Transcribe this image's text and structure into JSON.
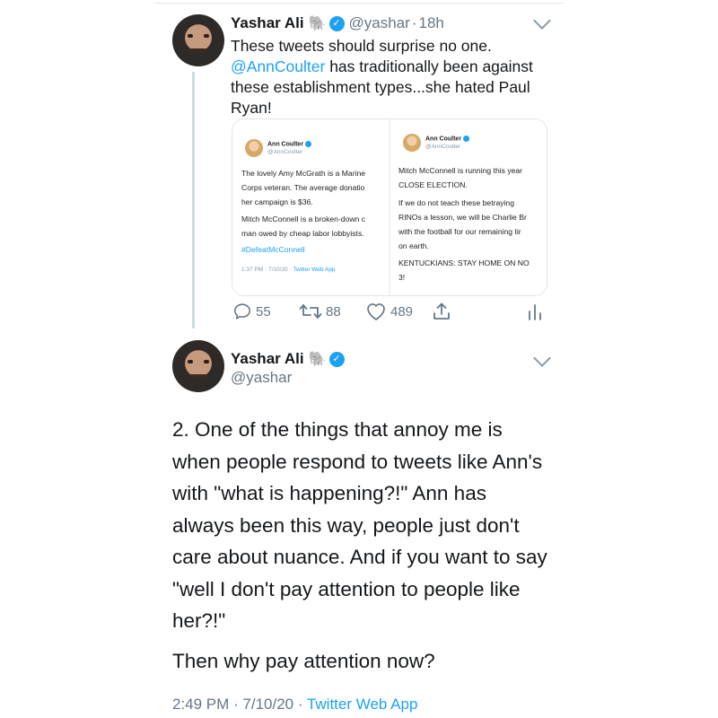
{
  "tweet1": {
    "author_name": "Yashar Ali",
    "handle": "@yashar",
    "separator": "·",
    "time": "18h",
    "text_line1": "These tweets should surprise no one.",
    "mention": "@AnnCoulter",
    "text_after_mention": " has traditionally been against these establishment types...she hated Paul Ryan!",
    "stats": {
      "replies": "55",
      "retweets": "88",
      "likes": "489"
    }
  },
  "embedded": {
    "left": {
      "name": "Ann Coulter",
      "handle": "@AnnCoulter",
      "lines": [
        "The lovely Amy McGrath is a Marine",
        "Corps veteran.  The average donatio",
        "her campaign is $36.",
        "Mitch McConnell is a broken-down c",
        "man owed by cheap labor lobbyists."
      ],
      "hashtag": "#DefeatMcConnell",
      "meta_time": "1:37 PM · 7/10/20 · ",
      "meta_source": "Twitter Web App"
    },
    "right": {
      "name": "Ann Coulter",
      "handle": "@AnnCoulter",
      "lines": [
        "Mitch McConnell is running this year",
        "CLOSE ELECTION.",
        "If we do not teach these betraying",
        "RINOs a lesson, we will be Charlie Br",
        "with the football for our remaining tir",
        "on earth.",
        "KENTUCKIANS: STAY HOME ON NO",
        "3!"
      ]
    }
  },
  "tweet2": {
    "author_name": "Yashar Ali",
    "handle": "@yashar",
    "paragraph1": "2. One of the things that annoy me is when people respond to tweets like Ann's with \"what is happening?!\" Ann has always been this way, people just don't care about nuance. And if you want to say \"well I don't pay attention to people like her?!\"",
    "paragraph2": "Then why pay attention now?",
    "footer_time": "2:49 PM · 7/10/20 · ",
    "footer_source": "Twitter Web App"
  },
  "icons": {
    "elephant": "elephant-emoji",
    "verified": "verified-badge-icon",
    "reply": "reply-icon",
    "retweet": "retweet-icon",
    "like": "heart-icon",
    "share": "share-icon",
    "analytics": "analytics-icon",
    "more": "chevron-down-icon"
  },
  "colors": {
    "link": "#1da1f2",
    "secondary": "#657786",
    "text": "#14171a"
  }
}
